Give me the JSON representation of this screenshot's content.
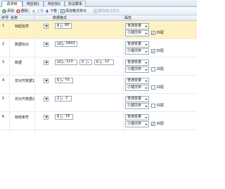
{
  "tabs": [
    {
      "label": "请求帧"
    },
    {
      "label": "响应帧1"
    },
    {
      "label": "响应帧2"
    },
    {
      "label": "协议脚本"
    }
  ],
  "toolbar": {
    "add": "添加",
    "delete": "删除",
    "up": "上移",
    "down": "下移",
    "add_format_unit": "添加格式单元",
    "delete_format_unit": "删除格式单元"
  },
  "table": {
    "columns": [
      "序号",
      "名称",
      "数据格式",
      "属性"
    ],
    "rows": [
      {
        "num": "1",
        "name": "帧起始符",
        "segments": [
          "8",
          "68"
        ],
        "attr_type": "普通变量",
        "attr_order": "小端次序",
        "match": true,
        "match_label": "匹配",
        "selected": true
      },
      {
        "num": "2",
        "name": "数据标识",
        "segments": [
          "16",
          "0A01"
        ],
        "attr_type": "普通变量",
        "attr_order": "小端次序",
        "match": true,
        "match_label": "匹配",
        "selected": false
      },
      {
        "num": "3",
        "name": "数据",
        "segments": [
          "10",
          "123",
          "0",
          "6",
          "12"
        ],
        "attr_type": "普通变量",
        "attr_order": "小端次序",
        "match": false,
        "match_label": "匹配",
        "selected": false
      },
      {
        "num": "4",
        "name": "非对齐数据1",
        "segments": [
          "6",
          "01"
        ],
        "attr_type": "普通变量",
        "attr_order": "小端次序",
        "match": false,
        "match_label": "匹配",
        "selected": false
      },
      {
        "num": "5",
        "name": "非对齐数据2",
        "segments": [
          "2",
          "2"
        ],
        "attr_type": "普通变量",
        "attr_order": "小端次序",
        "match": false,
        "match_label": "匹配",
        "selected": false
      },
      {
        "num": "6",
        "name": "帧结束符",
        "segments": [
          "8",
          "16"
        ],
        "attr_type": "普通变量",
        "attr_order": "小端次序",
        "match": true,
        "match_label": "匹配",
        "selected": false
      }
    ]
  },
  "colors": {
    "selected_row": "#fdf2c4",
    "header_border": "#9fb6d1",
    "add_icon": "#2e8b3a",
    "delete_icon": "#c0392b"
  }
}
